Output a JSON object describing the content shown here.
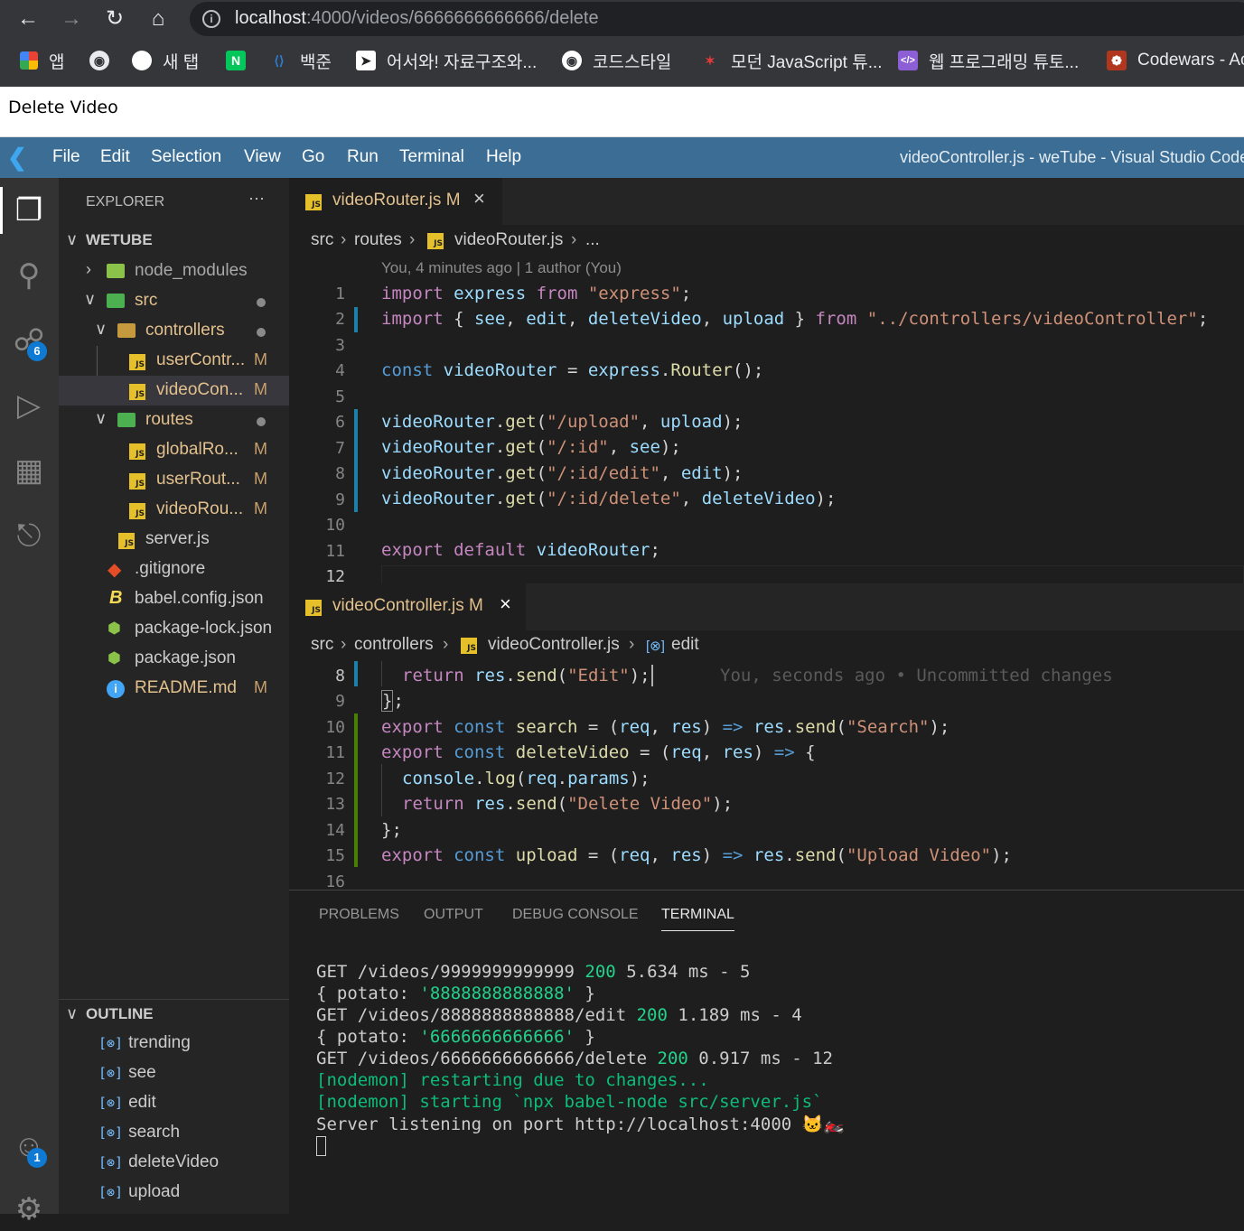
{
  "browser": {
    "url_host": "localhost",
    "url_path": ":4000/videos/6666666666666/delete",
    "bookmarks": [
      "앱",
      "새 탭",
      "백준",
      "어서와! 자료구조와...",
      "코드스타일",
      "모던 JavaScript 튜...",
      "웹 프로그래밍 튜토...",
      "Codewars - Ac"
    ]
  },
  "page": {
    "text": "Delete Video"
  },
  "vscode": {
    "menu": [
      "File",
      "Edit",
      "Selection",
      "View",
      "Go",
      "Run",
      "Terminal",
      "Help"
    ],
    "window_title": "videoController.js - weTube - Visual Studio Code",
    "badges": {
      "scm": "6",
      "accounts": "1"
    }
  },
  "explorer": {
    "title": "EXPLORER",
    "more": "···",
    "root": "WETUBE",
    "items": [
      {
        "label": "node_modules",
        "mark": ""
      },
      {
        "label": "src",
        "mark": ""
      },
      {
        "label": "controllers",
        "mark": ""
      },
      {
        "label": "userContr...",
        "mark": "M"
      },
      {
        "label": "videoCon...",
        "mark": "M"
      },
      {
        "label": "routes",
        "mark": ""
      },
      {
        "label": "globalRo...",
        "mark": "M"
      },
      {
        "label": "userRout...",
        "mark": "M"
      },
      {
        "label": "videoRou...",
        "mark": "M"
      },
      {
        "label": "server.js",
        "mark": ""
      },
      {
        "label": ".gitignore",
        "mark": ""
      },
      {
        "label": "babel.config.json",
        "mark": ""
      },
      {
        "label": "package-lock.json",
        "mark": ""
      },
      {
        "label": "package.json",
        "mark": ""
      },
      {
        "label": "README.md",
        "mark": "M"
      }
    ]
  },
  "outline": {
    "title": "OUTLINE",
    "items": [
      "trending",
      "see",
      "edit",
      "search",
      "deleteVideo",
      "upload"
    ]
  },
  "editor1": {
    "tab": "videoRouter.js",
    "tab_mark": "M",
    "crumbs": [
      "src",
      "routes",
      "videoRouter.js",
      "..."
    ],
    "blame": "You, 4 minutes ago | 1 author (You)"
  },
  "editor2": {
    "tab": "videoController.js",
    "tab_mark": "M",
    "crumbs": [
      "src",
      "controllers",
      "videoController.js",
      "edit"
    ],
    "inline_blame": "You, seconds ago • Uncommitted changes"
  },
  "panel": {
    "tabs": [
      "PROBLEMS",
      "OUTPUT",
      "DEBUG CONSOLE",
      "TERMINAL"
    ]
  },
  "terminal": {
    "lines": [
      {
        "pre": "GET /videos/9999999999999 ",
        "code": "200",
        "post": " 5.634 ms - 5"
      },
      {
        "pre": "{ potato: ",
        "str": "'8888888888888'",
        "post": " }"
      },
      {
        "pre": "GET /videos/8888888888888/edit ",
        "code": "200",
        "post": " 1.189 ms - 4"
      },
      {
        "pre": "{ potato: ",
        "str": "'6666666666666'",
        "post": " }"
      },
      {
        "pre": "GET /videos/6666666666666/delete ",
        "code": "200",
        "post": " 0.917 ms - 12"
      }
    ],
    "nodemon1": "[nodemon] restarting due to changes...",
    "nodemon2": "[nodemon] starting `npx babel-node src/server.js`",
    "server": "Server listening on port http://localhost:4000 🐱‍🏍"
  }
}
